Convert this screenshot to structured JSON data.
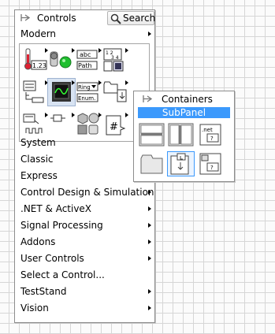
{
  "palette": {
    "title": "Controls",
    "search_label": "Search",
    "top_category": "Modern",
    "icons": [
      {
        "name": "numeric",
        "label": "1.23"
      },
      {
        "name": "boolean",
        "label": ""
      },
      {
        "name": "string-path",
        "label": "abc Path"
      },
      {
        "name": "array-matrix-cluster",
        "label": "1 2 3 4"
      },
      {
        "name": "list-table-tree",
        "label": ""
      },
      {
        "name": "graph",
        "label": ""
      },
      {
        "name": "ring-enum",
        "label": "Ring Enum."
      },
      {
        "name": "containers",
        "label": ""
      },
      {
        "name": "io",
        "label": ""
      },
      {
        "name": "variant-class",
        "label": ""
      },
      {
        "name": "decorations",
        "label": ""
      },
      {
        "name": "refnum",
        "label": "#"
      }
    ],
    "categories": [
      {
        "label": "System",
        "submenu": false
      },
      {
        "label": "Classic",
        "submenu": false
      },
      {
        "label": "Express",
        "submenu": false
      },
      {
        "label": "Control Design & Simulation",
        "submenu": true
      },
      {
        "label": ".NET & ActiveX",
        "submenu": true
      },
      {
        "label": "Signal Processing",
        "submenu": true
      },
      {
        "label": "Addons",
        "submenu": true
      },
      {
        "label": "User Controls",
        "submenu": true
      },
      {
        "label": "Select a Control...",
        "submenu": false
      },
      {
        "label": "TestStand",
        "submenu": true
      },
      {
        "label": "Vision",
        "submenu": true
      }
    ]
  },
  "subpalette": {
    "title": "Containers",
    "highlight": "SubPanel",
    "items": [
      {
        "name": "horizontal-splitter-bar",
        "label": ""
      },
      {
        "name": "vertical-splitter-bar",
        "label": ""
      },
      {
        "name": "net-container",
        "label": ".net"
      },
      {
        "name": "tab-control",
        "label": ""
      },
      {
        "name": "subpanel",
        "label": ""
      },
      {
        "name": "activex-container",
        "label": ""
      }
    ]
  },
  "colors": {
    "highlight": "#3b99fc",
    "border": "#8d8d8d",
    "grid": "#d6d6d6"
  }
}
